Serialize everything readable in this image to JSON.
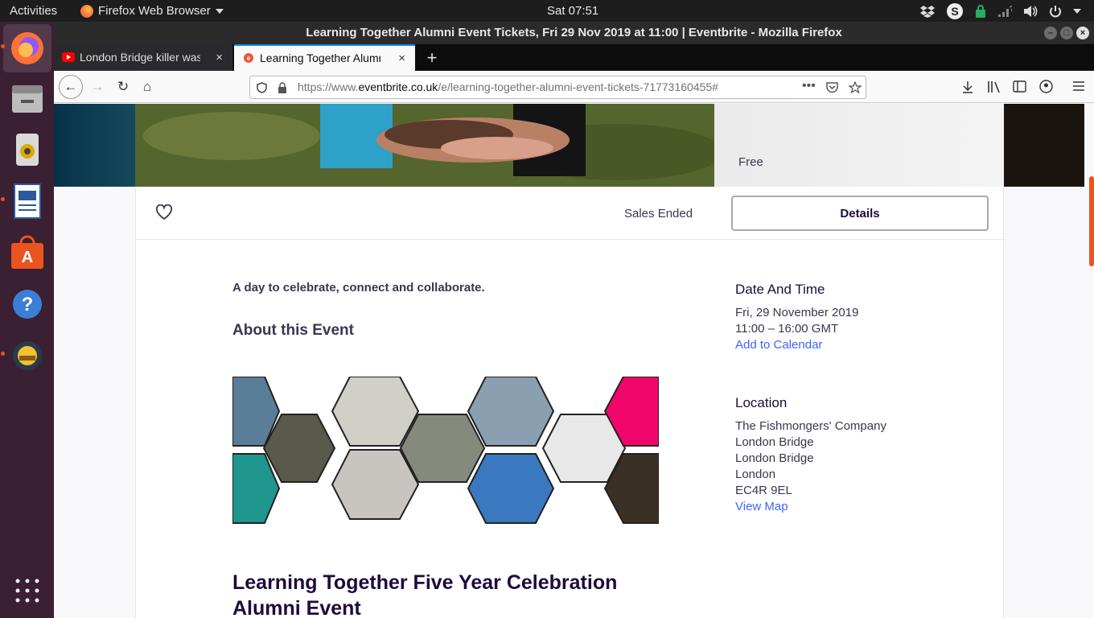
{
  "topbar": {
    "activities": "Activities",
    "app": "Firefox Web Browser",
    "clock": "Sat 07:51"
  },
  "window": {
    "title": "Learning Together Alumni Event Tickets, Fri 29 Nov 2019 at 11:00 | Eventbrite - Mozilla Firefox"
  },
  "tabs": [
    {
      "label": "London Bridge killer was"
    },
    {
      "label": "Learning Together Alumni"
    }
  ],
  "newtab": "+",
  "url": {
    "prefix": "https://www.",
    "domain": "eventbrite.co.uk",
    "path": "/e/learning-together-alumni-event-tickets-71773160455#"
  },
  "hero": {
    "price": "Free"
  },
  "actions": {
    "status": "Sales Ended",
    "details_label": "Details"
  },
  "event": {
    "summary": "A day to celebrate, connect and collaborate.",
    "about_heading": "About this Event",
    "title": "Learning Together Five Year Celebration Alumni Event"
  },
  "date_time": {
    "heading": "Date And Time",
    "date": "Fri, 29 November 2019",
    "time": "11:00 – 16:00 GMT",
    "calendar_link": "Add to Calendar"
  },
  "location": {
    "heading": "Location",
    "lines": [
      "The Fishmongers' Company",
      "London Bridge",
      "London Bridge",
      "London",
      "EC4R 9EL"
    ],
    "map_link": "View Map"
  },
  "colors": {
    "accent_link": "#3d64ff",
    "ubuntu_orange": "#e95420",
    "dock_bg": "#3b1f33"
  }
}
